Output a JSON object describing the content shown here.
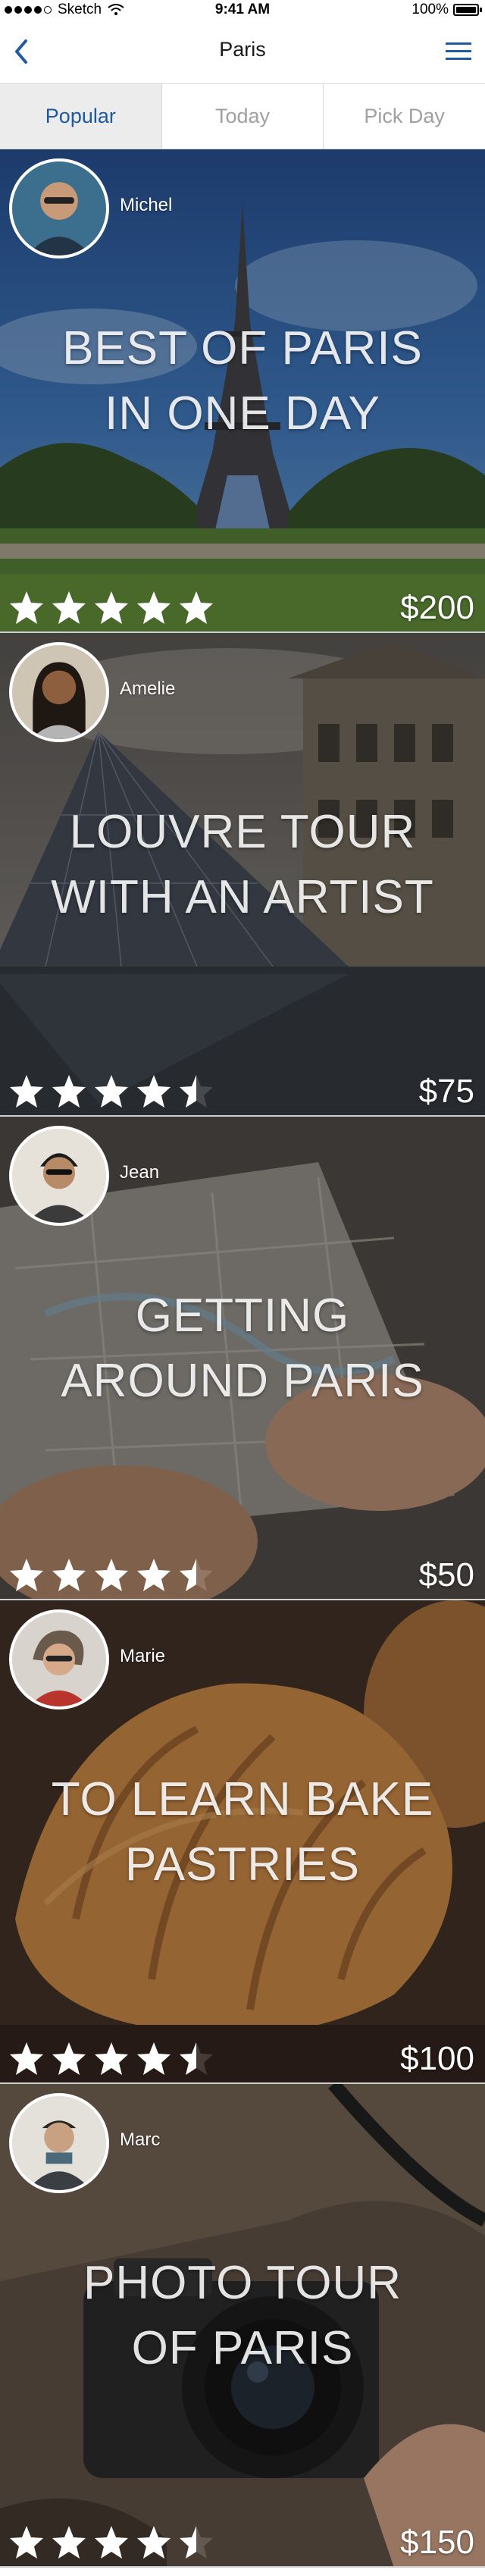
{
  "status_bar": {
    "carrier": "Sketch",
    "time": "9:41 AM",
    "battery": "100%"
  },
  "nav": {
    "title": "Paris",
    "back_icon": "chevron-left-icon",
    "menu_icon": "hamburger-menu-icon"
  },
  "colors": {
    "accent": "#1e5aa0",
    "tab_active_bg": "#ececec",
    "tab_inactive_text": "#a0a0a0"
  },
  "tabs": [
    {
      "label": "Popular",
      "active": true
    },
    {
      "label": "Today",
      "active": false
    },
    {
      "label": "Pick Day",
      "active": false
    }
  ],
  "tours": [
    {
      "host": "Michel",
      "title_line1": "BEST OF PARIS",
      "title_line2": "IN ONE DAY",
      "rating": 5,
      "price": "$200"
    },
    {
      "host": "Amelie",
      "title_line1": "LOUVRE TOUR",
      "title_line2": "WITH AN ARTIST",
      "rating": 4.5,
      "price": "$75"
    },
    {
      "host": "Jean",
      "title_line1": "GETTING",
      "title_line2": "AROUND PARIS",
      "rating": 4.5,
      "price": "$50"
    },
    {
      "host": "Marie",
      "title_line1": "TO LEARN BAKE",
      "title_line2": "PASTRIES",
      "rating": 4.5,
      "price": "$100"
    },
    {
      "host": "Marc",
      "title_line1": "PHOTO TOUR",
      "title_line2": "OF PARIS",
      "rating": 4.5,
      "price": "$150"
    }
  ]
}
